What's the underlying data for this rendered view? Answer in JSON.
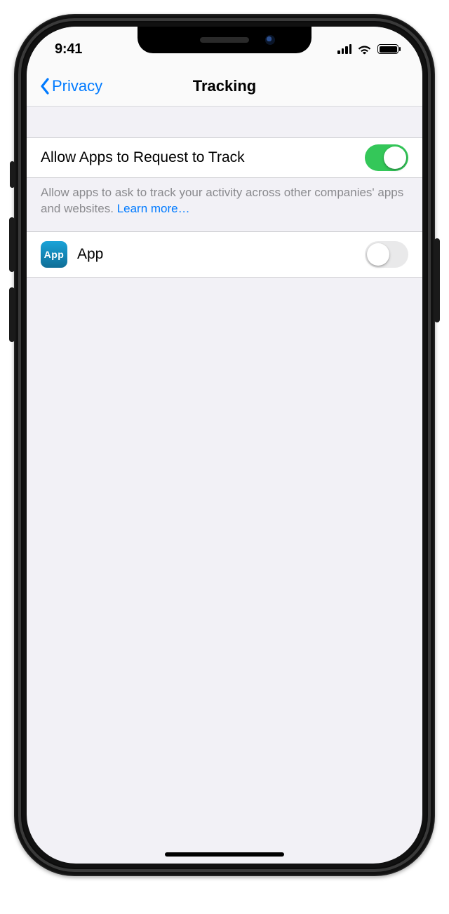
{
  "status": {
    "time": "9:41"
  },
  "nav": {
    "back_label": "Privacy",
    "title": "Tracking"
  },
  "settings": {
    "allow_label": "Allow Apps to Request to Track",
    "allow_on": true,
    "footer_text": "Allow apps to ask to track your activity across other companies' apps and websites. ",
    "learn_more": "Learn more…"
  },
  "apps": [
    {
      "icon_label": "App",
      "name": "App",
      "on": false
    }
  ],
  "colors": {
    "link": "#007aff",
    "toggle_on": "#34c759"
  }
}
